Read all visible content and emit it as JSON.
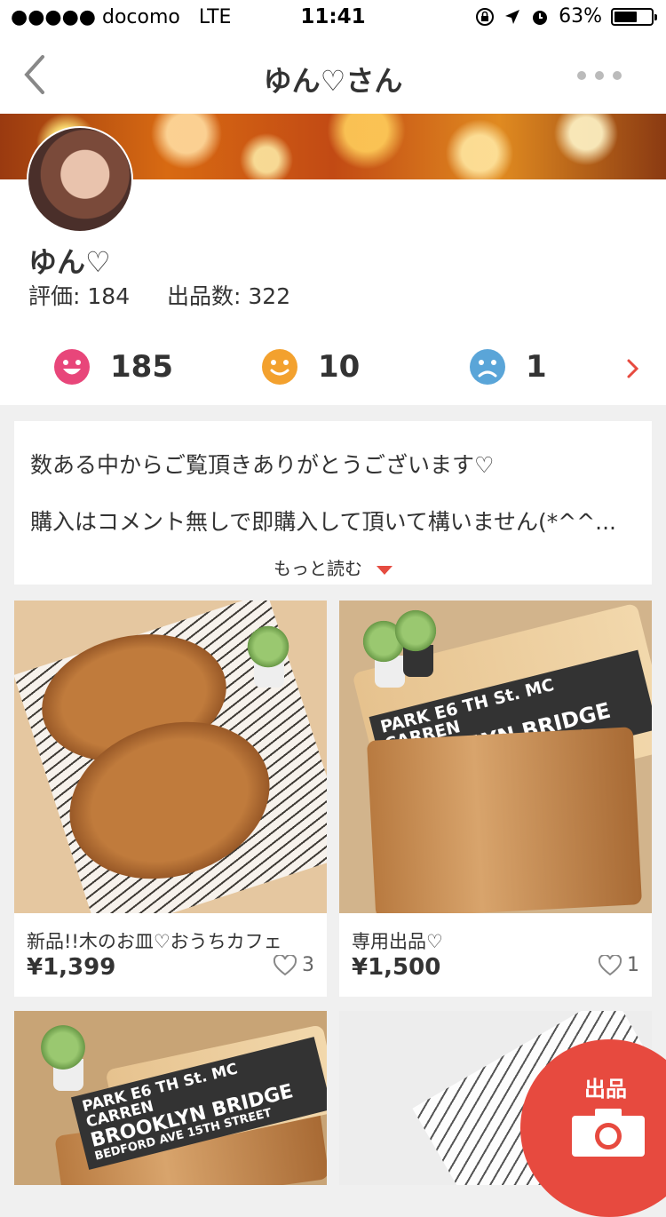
{
  "status_bar": {
    "carrier": "●●●●● docomo",
    "network": "LTE",
    "time": "11:41",
    "battery": "63%",
    "battery_level": 0.63
  },
  "nav": {
    "title": "ゆん♡さん"
  },
  "profile": {
    "name": "ゆん♡",
    "rating_label": "評価:",
    "rating_value": "184",
    "listings_label": "出品数:",
    "listings_value": "322"
  },
  "ratings": {
    "good": "185",
    "normal": "10",
    "bad": "1"
  },
  "bio": {
    "line1": "数ある中からご覧頂きありがとうございます♡",
    "line2": "購入はコメント無しで即購入して頂いて構いません(*^^...",
    "more": "もっと読む"
  },
  "items": [
    {
      "name": "新品!!木のお皿♡おうちカフェ",
      "price": "¥1,399",
      "likes": "3"
    },
    {
      "name": "専用出品♡",
      "price": "¥1,500",
      "likes": "1"
    }
  ],
  "banner_text": [
    "PARK E6 TH St. MC CARREN",
    "BROOKLYN BRIDGE",
    "BEDFORD AVE 15TH STREET"
  ],
  "fab": {
    "label": "出品"
  },
  "colors": {
    "accent": "#e74a3f",
    "good": "#e8467a",
    "normal": "#f3a12e",
    "bad": "#5aa5d8"
  }
}
